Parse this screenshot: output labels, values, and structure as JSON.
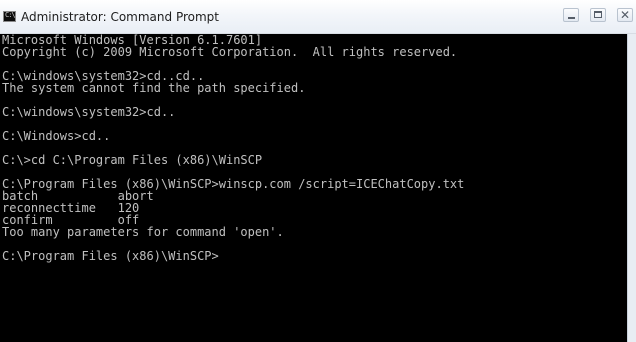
{
  "window": {
    "title": "Administrator: Command Prompt",
    "icon": "cmd-icon",
    "icon_text": "C:\\"
  },
  "controls": {
    "minimize": "minimize-icon",
    "maximize": "maximize-icon",
    "close_glyph": "✕"
  },
  "console": {
    "lines": [
      "Microsoft Windows [Version 6.1.7601]",
      "Copyright (c) 2009 Microsoft Corporation.  All rights reserved.",
      "",
      "C:\\windows\\system32>cd..cd..",
      "The system cannot find the path specified.",
      "",
      "C:\\windows\\system32>cd..",
      "",
      "C:\\Windows>cd..",
      "",
      "C:\\>cd C:\\Program Files (x86)\\WinSCP",
      "",
      "C:\\Program Files (x86)\\WinSCP>winscp.com /script=ICEChatCopy.txt",
      "batch           abort",
      "reconnecttime   120",
      "confirm         off",
      "Too many parameters for command 'open'.",
      "",
      "C:\\Program Files (x86)\\WinSCP>"
    ]
  }
}
